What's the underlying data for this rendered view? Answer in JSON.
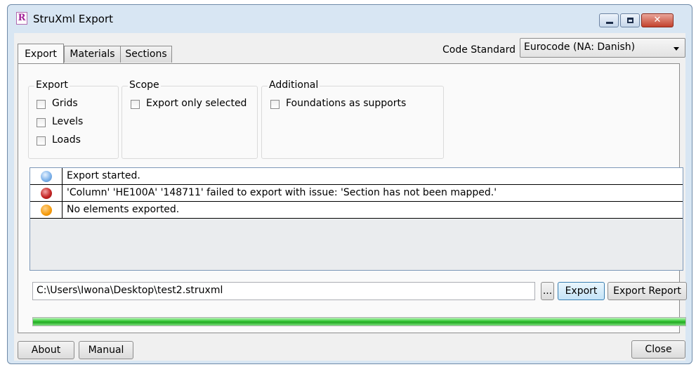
{
  "window": {
    "title": "StruXml Export",
    "app_icon_letter": "R",
    "controls": {
      "minimize": "minimize",
      "maximize": "maximize",
      "close": "✕"
    }
  },
  "tabs": [
    {
      "label": "Export",
      "active": true
    },
    {
      "label": "Materials",
      "active": false
    },
    {
      "label": "Sections",
      "active": false
    }
  ],
  "code_standard": {
    "label": "Code Standard",
    "selected": "Eurocode (NA: Danish)"
  },
  "groups": {
    "export": {
      "title": "Export",
      "options": [
        {
          "label": "Grids",
          "checked": false
        },
        {
          "label": "Levels",
          "checked": false
        },
        {
          "label": "Loads",
          "checked": false
        }
      ]
    },
    "scope": {
      "title": "Scope",
      "options": [
        {
          "label": "Export only selected",
          "checked": false
        }
      ]
    },
    "additional": {
      "title": "Additional",
      "options": [
        {
          "label": "Foundations as supports",
          "checked": false
        }
      ]
    }
  },
  "log": [
    {
      "level": "info",
      "color": "#7fb3ea",
      "message": "Export started."
    },
    {
      "level": "error",
      "color": "#c52626",
      "message": "'Column' 'HE100A' '148711' failed to export with issue: 'Section has not been mapped.'"
    },
    {
      "level": "warning",
      "color": "#f59a0a",
      "message": "No elements exported."
    }
  ],
  "file": {
    "path": "C:\\Users\\Iwona\\Desktop\\test2.struxml",
    "browse_label": "...",
    "export_label": "Export",
    "report_label": "Export Report"
  },
  "progress": {
    "value_percent": 100,
    "color": "#34c834"
  },
  "footer": {
    "about_label": "About",
    "manual_label": "Manual",
    "close_label": "Close"
  }
}
